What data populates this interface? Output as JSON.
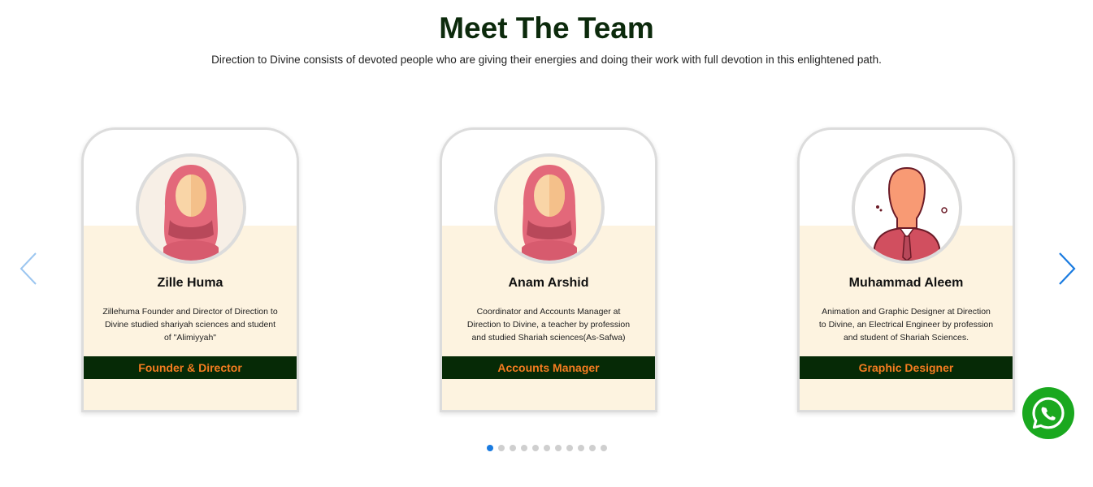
{
  "header": {
    "title": "Meet The Team",
    "subtitle": "Direction to Divine consists of devoted people who are giving their energies and doing their work with full devotion in this enlightened path."
  },
  "team": [
    {
      "name": "Zille Huma",
      "description": "Zillehuma Founder and Director of Direction to Divine studied shariyah sciences and student of \"Alimiyyah\"",
      "role": "Founder & Director",
      "avatar_icon": "female-hijab-avatar-icon"
    },
    {
      "name": "Anam Arshid",
      "description": "Coordinator and Accounts Manager at Direction to Divine, a teacher by profession and studied Shariah sciences(As-Safwa)",
      "role": "Accounts Manager",
      "avatar_icon": "female-hijab-avatar-icon"
    },
    {
      "name": "Muhammad Aleem",
      "description": "Animation and Graphic Designer at Direction to Divine, an Electrical Engineer by profession and student of Shariah Sciences.",
      "role": "Graphic Designer",
      "avatar_icon": "male-avatar-icon"
    }
  ],
  "carousel": {
    "prev_icon": "chevron-left-icon",
    "next_icon": "chevron-right-icon",
    "dot_count": 11,
    "active_index": 0
  },
  "whatsapp": {
    "icon": "whatsapp-icon"
  },
  "colors": {
    "title": "#0c2a0c",
    "role_bg": "#062a06",
    "role_text": "#f47c20",
    "card_bg": "#fdf3e0",
    "card_border": "#dcdcdc",
    "arrow": "#1a7be0",
    "whatsapp": "#1aa81f"
  }
}
